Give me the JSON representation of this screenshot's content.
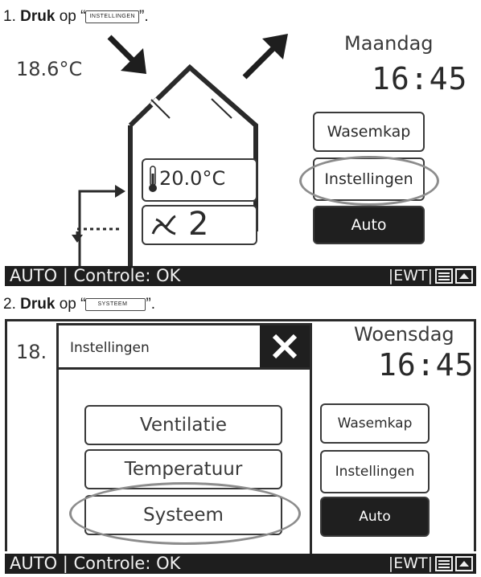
{
  "steps": [
    {
      "number": "1.",
      "verb": "Druk",
      "rest": "op",
      "key": "INSTELLINGEN"
    },
    {
      "number": "2.",
      "verb": "Druk",
      "rest": "op",
      "key": "SYSTEEM"
    }
  ],
  "screen1": {
    "outside_temp": "18.6°C",
    "day": "Maandag",
    "time": "16:45",
    "indoor_temp": "20.0°C",
    "fan_level": "2",
    "buttons": {
      "wasemkap": "Wasemkap",
      "instellingen": "Instellingen",
      "auto": "Auto"
    },
    "status": {
      "left": "AUTO | Controle: OK",
      "ewt": "|EWT|"
    }
  },
  "screen2": {
    "outside_temp_partial": "18.",
    "day": "Woensdag",
    "time": "16:45",
    "dialog": {
      "title": "Instellingen",
      "items": [
        "Ventilatie",
        "Temperatuur",
        "Systeem"
      ]
    },
    "buttons": {
      "wasemkap": "Wasemkap",
      "instellingen": "Instellingen",
      "auto": "Auto"
    },
    "status": {
      "left": "AUTO | Controle: OK",
      "ewt": "|EWT|"
    }
  },
  "colors": {
    "dark": "#1f1f1f",
    "highlight": "#8c8c8c"
  },
  "icons": [
    "arrow-in-icon",
    "arrow-out-icon",
    "house-icon",
    "thermometer-icon",
    "fan-icon",
    "close-icon",
    "bypass-icon",
    "eject-icon"
  ]
}
